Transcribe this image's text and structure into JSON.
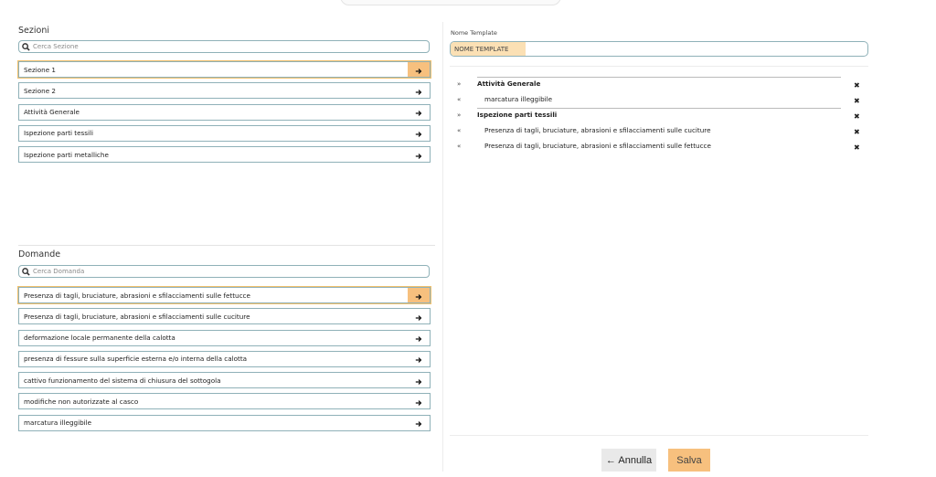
{
  "sections_panel": {
    "title": "Sezioni",
    "search_placeholder": "Cerca Sezione",
    "items": [
      "Sezione 1",
      "Sezione 2",
      "Attività Generale",
      "Ispezione parti tessili",
      "Ispezione parti metalliche"
    ]
  },
  "questions_panel": {
    "title": "Domande",
    "search_placeholder": "Cerca Domanda",
    "items": [
      "Presenza di tagli, bruciature, abrasioni e sfilacciamenti sulle fettucce",
      "Presenza di tagli, bruciature, abrasioni e sfilacciamenti sulle cuciture",
      "deformazione locale permanente della calotta",
      "presenza di fessure sulla superficie esterna e/o interna della calotta",
      "cattivo funzionamento del sistema di chiusura del sottogola",
      "modifiche non autorizzate al casco",
      "marcatura illeggibile"
    ]
  },
  "template": {
    "name_label": "Nome Template",
    "name_value": "NOME TEMPLATE",
    "rows": [
      {
        "mark": "»",
        "text": "Attività Generale"
      },
      {
        "mark": "«",
        "text": "marcatura illeggibile"
      },
      {
        "mark": "»",
        "text": "Ispezione parti tessili"
      },
      {
        "mark": "«",
        "text": "Presenza di tagli, bruciature, abrasioni e sfilacciamenti sulle cuciture"
      },
      {
        "mark": "«",
        "text": "Presenza di tagli, bruciature, abrasioni e sfilacciamenti sulle fettucce"
      }
    ],
    "remove_glyph": "✖"
  },
  "actions": {
    "cancel_label": "← Annulla",
    "save_label": "Salva"
  },
  "colors": {
    "accent": "#f7c07e",
    "border": "#8fb1b8"
  }
}
